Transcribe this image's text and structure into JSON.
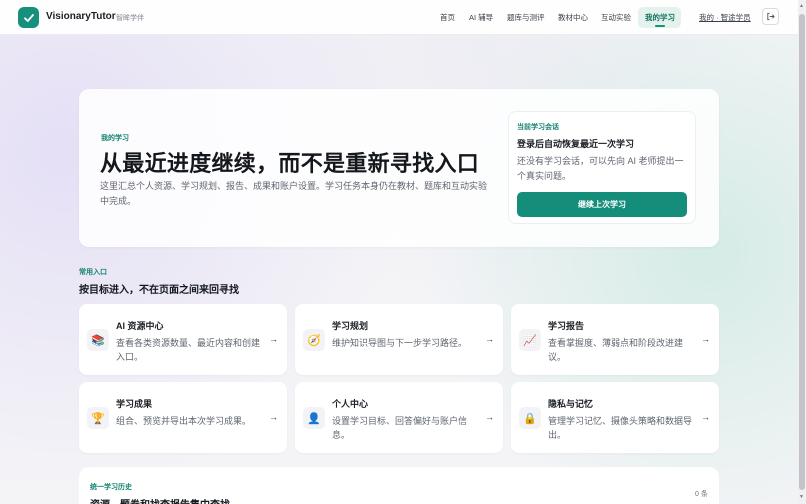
{
  "app": {
    "name": "VisionaryTutor",
    "subtitle": "智眸学伴"
  },
  "nav": {
    "items": [
      "首页",
      "AI 辅导",
      "题库与测评",
      "教材中心",
      "互动实验",
      "我的学习"
    ],
    "active": "我的学习",
    "user": "我的 · 智途学员"
  },
  "hero": {
    "eyebrow": "我的学习",
    "title": "从最近进度继续，而不是重新寻找入口",
    "description": "这里汇总个人资源、学习规划、报告、成果和账户设置。学习任务本身仍在教材、题库和互动实验中完成。"
  },
  "session": {
    "eyebrow": "当前学习会话",
    "title": "登录后自动恢复最近一次学习",
    "description": "还没有学习会话，可以先向 AI 老师提出一个真实问题。",
    "button": "继续上次学习"
  },
  "shortcuts": {
    "eyebrow": "常用入口",
    "title": "按目标进入，不在页面之间来回寻找",
    "cards": [
      {
        "title": "AI 资源中心",
        "desc": "查看各类资源数量、最近内容和创建入口。",
        "icon": "books-icon",
        "glyph": "📚"
      },
      {
        "title": "学习规划",
        "desc": "维护知识导图与下一步学习路径。",
        "icon": "compass-icon",
        "glyph": "🧭"
      },
      {
        "title": "学习报告",
        "desc": "查看掌握度、薄弱点和阶段改进建议。",
        "icon": "chart-icon",
        "glyph": "📈"
      },
      {
        "title": "学习成果",
        "desc": "组合、预览并导出本次学习成果。",
        "icon": "trophy-icon",
        "glyph": "🏆"
      },
      {
        "title": "个人中心",
        "desc": "设置学习目标、回答偏好与账户信息。",
        "icon": "person-icon",
        "glyph": "👤"
      },
      {
        "title": "隐私与记忆",
        "desc": "管理学习记忆、摄像头策略和数据导出。",
        "icon": "lock-icon",
        "glyph": "🔒"
      }
    ],
    "arrow": "→"
  },
  "history": {
    "eyebrow": "统一学习历史",
    "title": "资源、题卷和找查报告集中查找",
    "count": "0 条"
  },
  "colors": {
    "accent": "#158d7b",
    "accent_light": "#e4f2ee"
  }
}
